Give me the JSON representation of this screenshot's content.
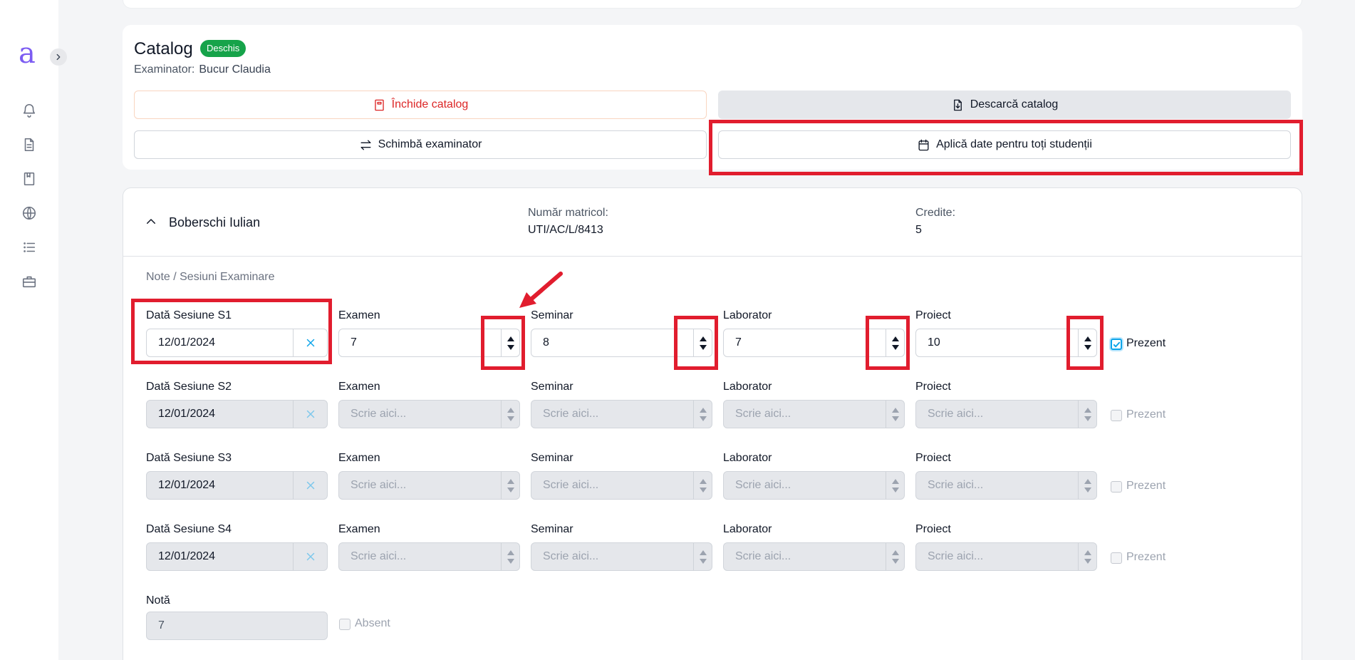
{
  "app": {
    "logo_letter": "a"
  },
  "sidebar": {
    "icons": [
      "bell-icon",
      "document-icon",
      "book-icon",
      "globe-icon",
      "list-icon",
      "briefcase-icon"
    ]
  },
  "catalog": {
    "title": "Catalog",
    "status_badge": "Deschis",
    "examiner_label": "Examinator:",
    "examiner_name": "Bucur Claudia",
    "buttons": {
      "close": "Închide catalog",
      "download": "Descarcă catalog",
      "change_examiner": "Schimbă examinator",
      "apply_dates": "Aplică date pentru toți studenții"
    }
  },
  "student": {
    "name": "Boberschi Iulian",
    "matricol_label": "Număr matricol:",
    "matricol_value": "UTI/AC/L/8413",
    "credits_label": "Credite:",
    "credits_value": "5",
    "section_label": "Note / Sesiuni Examinare",
    "columns": {
      "exam": "Examen",
      "seminar": "Seminar",
      "lab": "Laborator",
      "project": "Proiect"
    },
    "present_label": "Prezent",
    "placeholder": "Scrie aici...",
    "sessions": [
      {
        "label": "Dată Sesiune S1",
        "date": "12/01/2024",
        "exam": "7",
        "seminar": "8",
        "lab": "7",
        "project": "10",
        "present": true,
        "enabled": true
      },
      {
        "label": "Dată Sesiune S2",
        "date": "12/01/2024",
        "exam": "",
        "seminar": "",
        "lab": "",
        "project": "",
        "present": false,
        "enabled": false
      },
      {
        "label": "Dată Sesiune S3",
        "date": "12/01/2024",
        "exam": "",
        "seminar": "",
        "lab": "",
        "project": "",
        "present": false,
        "enabled": false
      },
      {
        "label": "Dată Sesiune S4",
        "date": "12/01/2024",
        "exam": "",
        "seminar": "",
        "lab": "",
        "project": "",
        "present": false,
        "enabled": false
      }
    ],
    "grade_label": "Notă",
    "grade_value": "7",
    "absent_label": "Absent"
  },
  "colors": {
    "accent": "#0ea5e9",
    "badge": "#16a34a",
    "danger": "#dc2626",
    "annotation": "#e11d2e",
    "logo": "#7c5cf2"
  }
}
